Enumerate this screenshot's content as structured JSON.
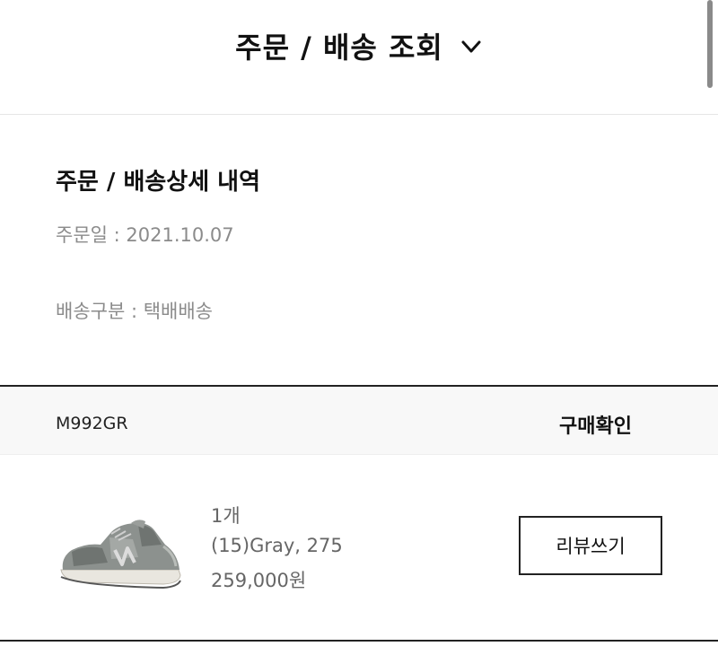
{
  "header": {
    "title": "주문 / 배송 조회",
    "dropdown_icon": "chevron-down-icon"
  },
  "order_detail": {
    "title": "주문 / 배송상세 내역",
    "order_date": "주문일 : 2021.10.07",
    "delivery_type": "배송구분 : 택배배송"
  },
  "order_bar": {
    "product_code": "M992GR",
    "status": "구매확인"
  },
  "item": {
    "image_icon": "sneaker-image",
    "quantity": "1개",
    "option": "(15)Gray, 275",
    "price": "259,000원",
    "review_button": "리뷰쓰기"
  }
}
